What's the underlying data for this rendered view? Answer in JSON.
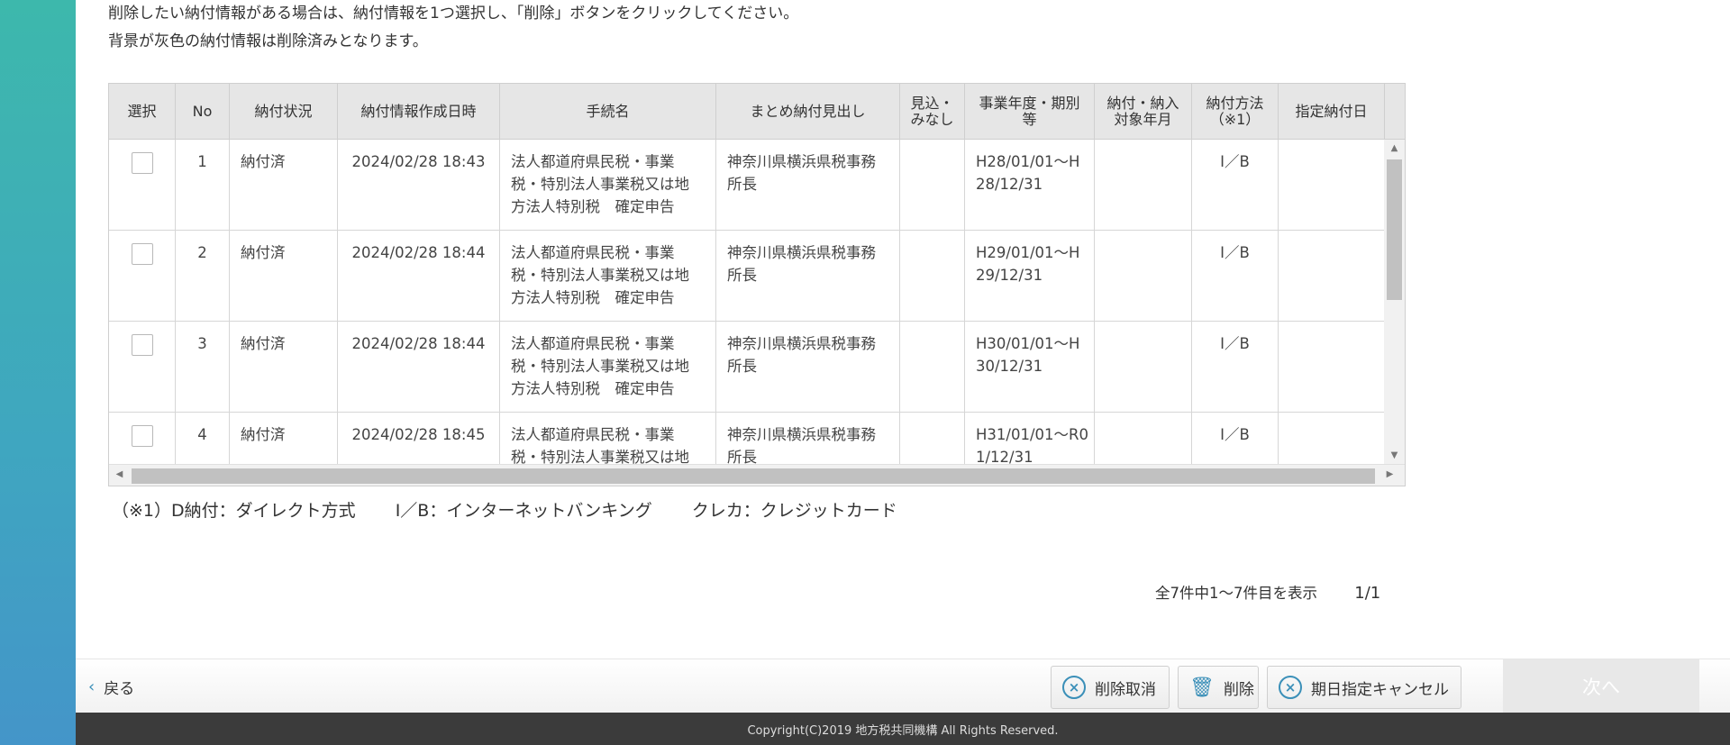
{
  "intro": {
    "line1": "削除したい納付情報がある場合は、納付情報を1つ選択し、「削除」ボタンをクリックしてください。",
    "line2": "背景が灰色の納付情報は削除済みとなります。"
  },
  "table": {
    "headers": {
      "select": "選択",
      "no": "No",
      "status": "納付状況",
      "created": "納付情報作成日時",
      "procedure": "手続名",
      "summary": "まとめ納付見出し",
      "estimate": "見込・みなし",
      "period": "事業年度・期別等",
      "target_month": "納付・納入対象年月",
      "method": "納付方法（※1）",
      "due_date": "指定納付日"
    },
    "rows": [
      {
        "no": "1",
        "status": "納付済",
        "created": "2024/02/28 18:43",
        "procedure": "法人都道府県民税・事業税・特別法人事業税又は地方法人特別税　確定申告",
        "summary": "神奈川県横浜県税事務所長",
        "estimate": "",
        "period": "H28/01/01～H28/12/31",
        "target_month": "",
        "method": "I／B",
        "due_date": ""
      },
      {
        "no": "2",
        "status": "納付済",
        "created": "2024/02/28 18:44",
        "procedure": "法人都道府県民税・事業税・特別法人事業税又は地方法人特別税　確定申告",
        "summary": "神奈川県横浜県税事務所長",
        "estimate": "",
        "period": "H29/01/01～H29/12/31",
        "target_month": "",
        "method": "I／B",
        "due_date": ""
      },
      {
        "no": "3",
        "status": "納付済",
        "created": "2024/02/28 18:44",
        "procedure": "法人都道府県民税・事業税・特別法人事業税又は地方法人特別税　確定申告",
        "summary": "神奈川県横浜県税事務所長",
        "estimate": "",
        "period": "H30/01/01～H30/12/31",
        "target_month": "",
        "method": "I／B",
        "due_date": ""
      },
      {
        "no": "4",
        "status": "納付済",
        "created": "2024/02/28 18:45",
        "procedure": "法人都道府県民税・事業税・特別法人事業税又は地方法人特別税　確定申告",
        "summary": "神奈川県横浜県税事務所長",
        "estimate": "",
        "period": "H31/01/01～R01/12/31",
        "target_month": "",
        "method": "I／B",
        "due_date": ""
      }
    ]
  },
  "note": {
    "item1": "（※1）D納付：ダイレクト方式",
    "item2": "I／B：インターネットバンキング",
    "item3": "クレカ：クレジットカード"
  },
  "pager": {
    "summary": "全7件中1～7件目を表示",
    "page": "1/1"
  },
  "actions": {
    "back": "戻る",
    "cancel_delete": "削除取消",
    "delete": "削除",
    "cancel_due_date": "期日指定キャンセル",
    "next": "次へ"
  },
  "footer": {
    "copyright": "Copyright(C)2019 地方税共同機構 All Rights Reserved."
  },
  "colors": {
    "accent": "#3a8fb8",
    "header_bg": "#e6e6e6",
    "footer_bg": "#3b3b3b"
  }
}
